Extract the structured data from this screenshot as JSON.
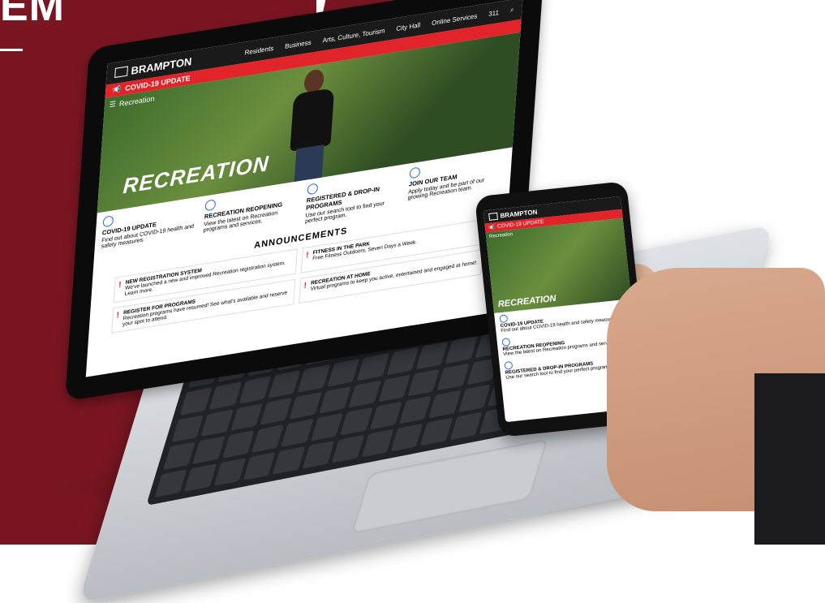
{
  "corner": {
    "title": "EM"
  },
  "laptop": {
    "brand": "BRAMPTON",
    "nav": [
      "Residents",
      "Business",
      "Arts, Culture, Tourism",
      "City Hall",
      "Online Services",
      "311"
    ],
    "covid_banner": "COVID-19 UPDATE",
    "breadcrumb": "Recreation",
    "hero_title": "RECREATION",
    "features": [
      {
        "title": "COVID-19 UPDATE",
        "text": "Find out about COVID-19 health and safety measures."
      },
      {
        "title": "RECREATION REOPENING",
        "text": "View the latest on Recreation programs and services."
      },
      {
        "title": "REGISTERED & DROP-IN PROGRAMS",
        "text": "Use our search tool to find your perfect program."
      },
      {
        "title": "JOIN OUR TEAM",
        "text": "Apply today and be part of our growing Recreation team."
      }
    ],
    "announcements_title": "ANNOUNCEMENTS",
    "announcements": [
      {
        "title": "NEW REGISTRATION SYSTEM",
        "text": "We've launched a new and improved Recreation registration system. Learn more."
      },
      {
        "title": "FITNESS IN THE PARK",
        "text": "Free Fitness Outdoors, Seven Days a Week."
      },
      {
        "title": "REGISTER FOR PROGRAMS",
        "text": "Recreation programs have resumed! See what's available and reserve your spot to attend."
      },
      {
        "title": "RECREATION AT HOME",
        "text": "Virtual programs to keep you active, entertained and engaged at home!"
      }
    ]
  },
  "phone": {
    "brand": "BRAMPTON",
    "covid_banner": "COVID-19 UPDATE",
    "breadcrumb": "Recreation",
    "hero_title": "RECREATION",
    "features": [
      {
        "title": "COVID-19 UPDATE",
        "text": "Find out about COVID-19 health and safety measures."
      },
      {
        "title": "RECREATION REOPENING",
        "text": "View the latest on Recreation programs and services."
      },
      {
        "title": "REGISTERED & DROP-IN PROGRAMS",
        "text": "Use our search tool to find your perfect program."
      }
    ]
  },
  "colors": {
    "maroon": "#7a1622",
    "brand_red": "#e1242a",
    "nav_dark": "#1a1a1a",
    "icon_blue": "#2c6bd8"
  }
}
